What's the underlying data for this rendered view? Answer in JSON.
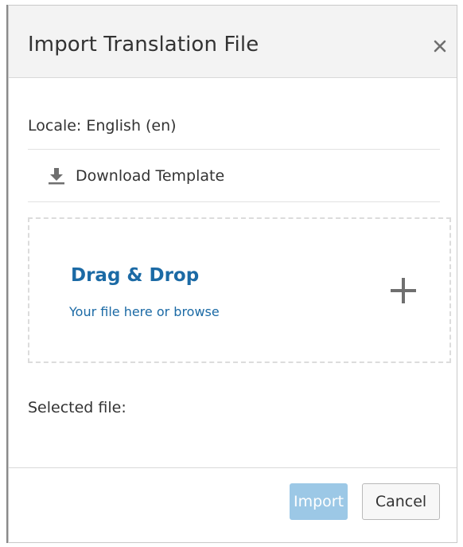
{
  "dialog": {
    "title": "Import Translation File",
    "close_icon": "close-icon"
  },
  "locale": {
    "text": "Locale: English (en)"
  },
  "download": {
    "icon": "download-icon",
    "label": "Download Template"
  },
  "dropzone": {
    "title": "Drag & Drop",
    "subtitle": "Your file here or browse",
    "icon": "plus-icon"
  },
  "selected_file": {
    "label": "Selected file:"
  },
  "footer": {
    "import_label": "Import",
    "cancel_label": "Cancel"
  },
  "colors": {
    "header_bg": "#f3f3f3",
    "link_blue": "#1b6aa5",
    "import_disabled": "#9cc8e6",
    "text": "#333333"
  }
}
